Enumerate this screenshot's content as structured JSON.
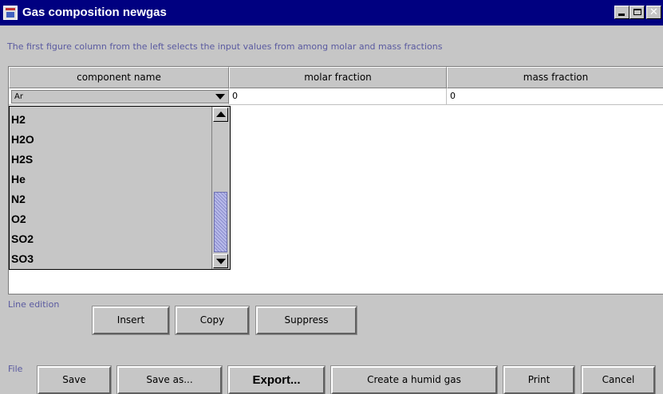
{
  "window": {
    "title": "Gas composition newgas",
    "controls": [
      "minimize",
      "maximize",
      "close"
    ]
  },
  "info_text": "The first figure column from the left selects the input values from among molar and mass fractions",
  "table": {
    "columns": [
      "component name",
      "molar fraction",
      "mass fraction"
    ],
    "rows": [
      {
        "component": "Ar",
        "molar_fraction": "0",
        "mass_fraction": "0"
      }
    ]
  },
  "dropdown": {
    "options": [
      "H2",
      "H2O",
      "H2S",
      "He",
      "N2",
      "O2",
      "SO2",
      "SO3"
    ]
  },
  "line_edition": {
    "label": "Line edition",
    "insert": "Insert",
    "copy": "Copy",
    "suppress": "Suppress"
  },
  "file": {
    "label": "File",
    "save": "Save",
    "save_as": "Save as...",
    "export": "Export...",
    "create_humid": "Create a humid gas",
    "print": "Print",
    "cancel": "Cancel"
  },
  "colors": {
    "titlebar": "#000080",
    "window_bg": "#c6c6c6",
    "info_text": "#5a5aa0",
    "scroll_thumb": "#9fa2d8"
  }
}
